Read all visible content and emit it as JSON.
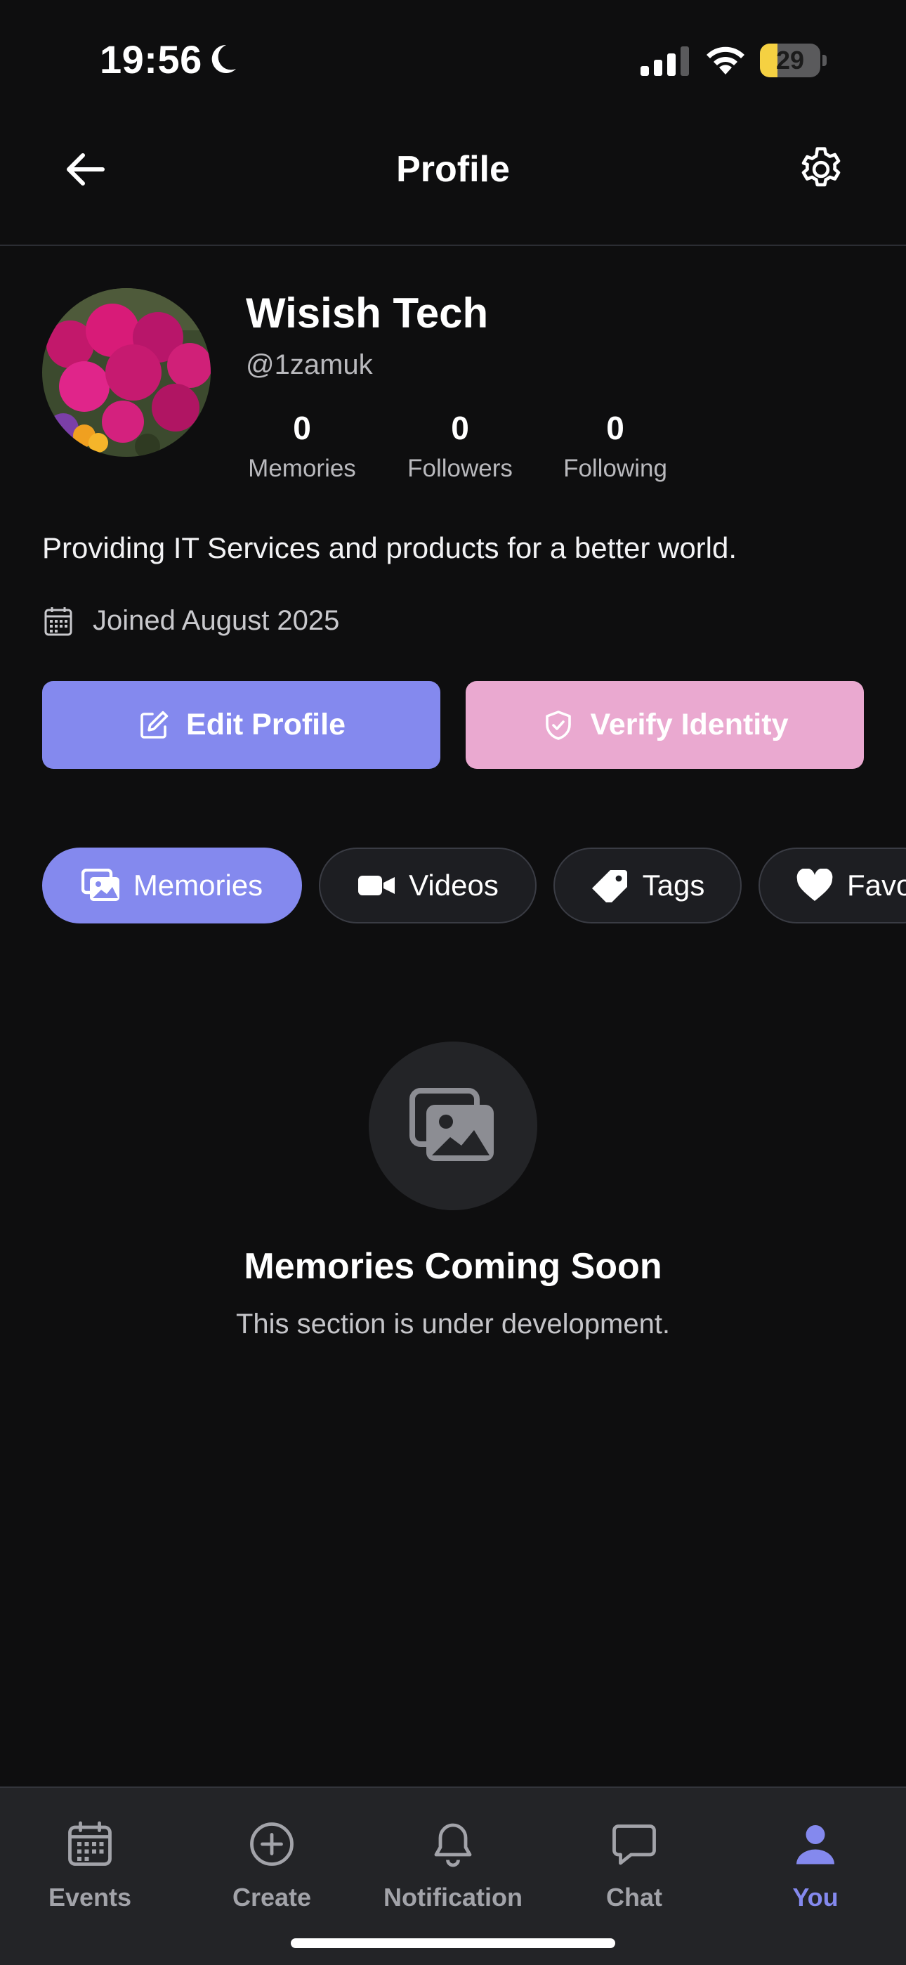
{
  "status_bar": {
    "time": "19:56",
    "battery": "29",
    "battery_level": 0.29,
    "icons": [
      "moon-icon",
      "cellular-signal-icon",
      "wifi-icon",
      "battery-icon"
    ]
  },
  "header": {
    "title": "Profile",
    "back_icon": "arrow-left-icon",
    "settings_icon": "gear-icon"
  },
  "profile": {
    "name": "Wisish Tech",
    "handle": "@1zamuk",
    "stats": [
      {
        "value": "0",
        "label": "Memories"
      },
      {
        "value": "0",
        "label": "Followers"
      },
      {
        "value": "0",
        "label": "Following"
      }
    ],
    "bio": "Providing IT Services and products for a better world.",
    "joined": "Joined August 2025"
  },
  "actions": {
    "edit_profile": "Edit Profile",
    "verify_identity": "Verify Identity",
    "edit_color": "#8489ee",
    "verify_color": "#eaa9d0"
  },
  "tabs": [
    {
      "label": "Memories",
      "icon": "images-icon",
      "active": true
    },
    {
      "label": "Videos",
      "icon": "video-camera-icon",
      "active": false
    },
    {
      "label": "Tags",
      "icon": "tag-icon",
      "active": false
    },
    {
      "label": "Favo",
      "icon": "heart-icon",
      "active": false
    }
  ],
  "empty_state": {
    "title": "Memories Coming Soon",
    "subtitle": "This section is under development.",
    "icon": "images-icon"
  },
  "bottom_nav": {
    "items": [
      {
        "label": "Events",
        "icon": "calendar-icon"
      },
      {
        "label": "Create",
        "icon": "plus-circle-icon"
      },
      {
        "label": "Notification",
        "icon": "bell-icon"
      },
      {
        "label": "Chat",
        "icon": "chat-bubble-icon"
      },
      {
        "label": "You",
        "icon": "user-icon",
        "active": true
      }
    ],
    "active_color": "#8489ee"
  }
}
